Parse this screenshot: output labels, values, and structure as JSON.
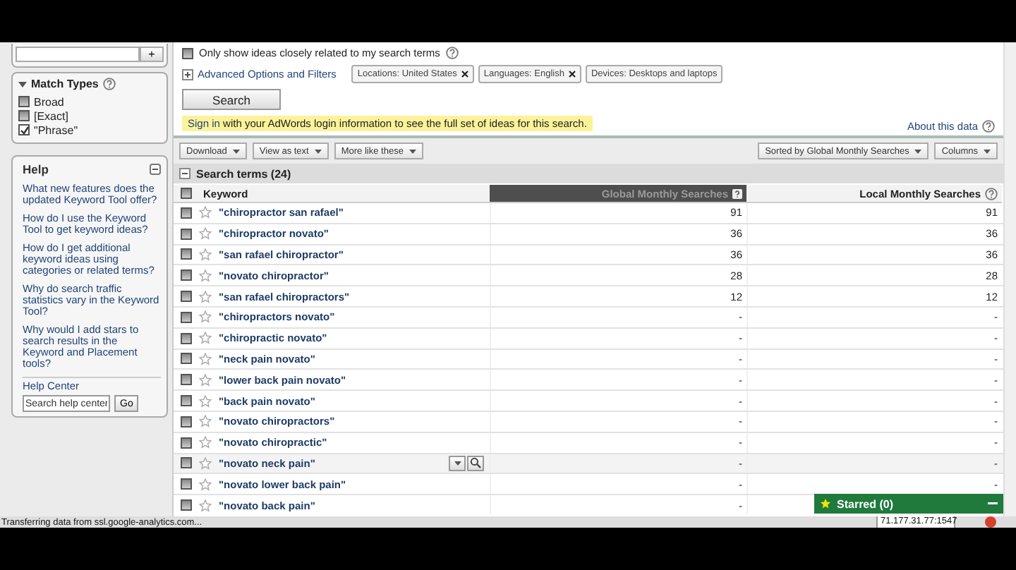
{
  "sidebar": {
    "add_button": "+",
    "match_types": {
      "title": "Match Types",
      "expanded": true,
      "options": [
        {
          "label": "Broad",
          "checked": false
        },
        {
          "label": "[Exact]",
          "checked": false
        },
        {
          "label": "\"Phrase\"",
          "checked": true
        }
      ]
    },
    "help": {
      "title": "Help",
      "links": [
        "What new features does the updated Keyword Tool offer?",
        "How do I use the Keyword Tool to get keyword ideas?",
        "How do I get additional keyword ideas using categories or related terms?",
        "Why do search traffic statistics vary in the Keyword Tool?",
        "Why would I add stars to search results in the Keyword and Placement tools?"
      ],
      "help_center": "Help Center",
      "search_placeholder": "Search help center",
      "go_button": "Go"
    }
  },
  "query": {
    "closely_related": {
      "label": "Only show ideas closely related to my search terms",
      "checked": false
    },
    "advanced": {
      "label": "Advanced Options and Filters",
      "expanded": false
    },
    "filters": [
      {
        "label": "Locations: United States",
        "removable": true
      },
      {
        "label": "Languages: English",
        "removable": true
      },
      {
        "label": "Devices: Desktops and laptops",
        "removable": false
      }
    ],
    "search_button": "Search",
    "notice": {
      "link": "Sign in",
      "text": "with your AdWords login information to see the full set of ideas for this search."
    },
    "about": "About this data"
  },
  "toolbar": {
    "left": [
      "Download",
      "View as text",
      "More like these"
    ],
    "right": [
      "Sorted by Global Monthly Searches",
      "Columns"
    ]
  },
  "table": {
    "title": "Search terms (24)",
    "expanded": true,
    "all_checked": false,
    "columns": [
      {
        "label": "Keyword",
        "sorted": false
      },
      {
        "label": "Global Monthly Searches",
        "sorted": true
      },
      {
        "label": "Local Monthly Searches",
        "sorted": false
      }
    ],
    "rows": [
      {
        "keyword": "\"chiropractor san rafael\"",
        "global": "91",
        "local": "91",
        "checked": false,
        "starred": false,
        "hovered": false
      },
      {
        "keyword": "\"chiropractor novato\"",
        "global": "36",
        "local": "36",
        "checked": false,
        "starred": false,
        "hovered": false
      },
      {
        "keyword": "\"san rafael chiropractor\"",
        "global": "36",
        "local": "36",
        "checked": false,
        "starred": false,
        "hovered": false
      },
      {
        "keyword": "\"novato chiropractor\"",
        "global": "28",
        "local": "28",
        "checked": false,
        "starred": false,
        "hovered": false
      },
      {
        "keyword": "\"san rafael chiropractors\"",
        "global": "12",
        "local": "12",
        "checked": false,
        "starred": false,
        "hovered": false
      },
      {
        "keyword": "\"chiropractors novato\"",
        "global": "-",
        "local": "-",
        "checked": false,
        "starred": false,
        "hovered": false
      },
      {
        "keyword": "\"chiropractic novato\"",
        "global": "-",
        "local": "-",
        "checked": false,
        "starred": false,
        "hovered": false
      },
      {
        "keyword": "\"neck pain novato\"",
        "global": "-",
        "local": "-",
        "checked": false,
        "starred": false,
        "hovered": false
      },
      {
        "keyword": "\"lower back pain novato\"",
        "global": "-",
        "local": "-",
        "checked": false,
        "starred": false,
        "hovered": false
      },
      {
        "keyword": "\"back pain novato\"",
        "global": "-",
        "local": "-",
        "checked": false,
        "starred": false,
        "hovered": false
      },
      {
        "keyword": "\"novato chiropractors\"",
        "global": "-",
        "local": "-",
        "checked": false,
        "starred": false,
        "hovered": false
      },
      {
        "keyword": "\"novato chiropractic\"",
        "global": "-",
        "local": "-",
        "checked": false,
        "starred": false,
        "hovered": false
      },
      {
        "keyword": "\"novato neck pain\"",
        "global": "-",
        "local": "-",
        "checked": false,
        "starred": false,
        "hovered": true
      },
      {
        "keyword": "\"novato lower back pain\"",
        "global": "-",
        "local": "-",
        "checked": false,
        "starred": false,
        "hovered": false
      },
      {
        "keyword": "\"novato back pain\"",
        "global": "-",
        "checked": false,
        "starred": false,
        "hovered": false
      }
    ]
  },
  "starred_panel": {
    "title": "Starred (0)"
  },
  "status_bar": {
    "text": "Transferring data from ssl.google-analytics.com...",
    "address": "71.177.31.77:1547"
  }
}
